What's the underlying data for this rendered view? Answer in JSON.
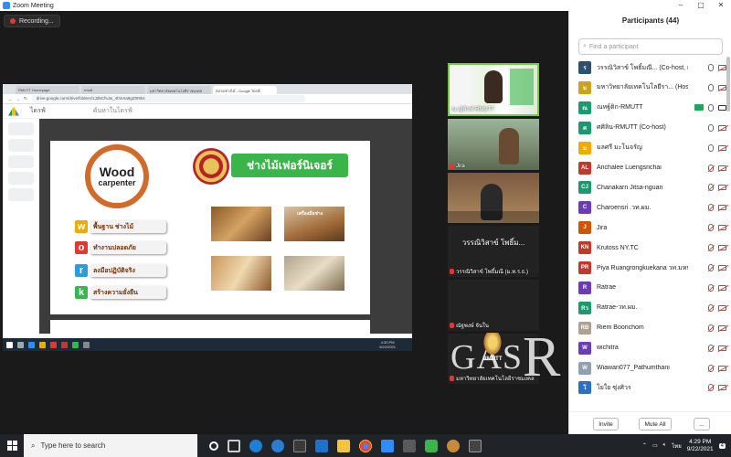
{
  "window": {
    "title": "Zoom Meeting"
  },
  "recording": {
    "label": "Recording..."
  },
  "browser": {
    "tabs": [
      "RMUTT Homepage",
      "rmutt",
      "มหาวิทยาลัยเทคโนโลยีราชมงคล",
      "ตลาดช่างไม้ - Google ไดรฟ์"
    ],
    "url": "drive.google.com/drive/folders/1Jd5CfsJw_4f4nXa8gZ0I9k4"
  },
  "drive": {
    "app_label": "ไดรฟ์",
    "search_label": "ค้นหาในไดรฟ์"
  },
  "slide": {
    "logo_line1": "Wood",
    "logo_line2": "carpenter",
    "title": "ช่างไม้เฟอร์นิเจอร์",
    "photo_caption": "เครื่องมือช่าง",
    "items": [
      {
        "letter": "w",
        "text": "พื้นฐาน ช่างไม้",
        "color": "#f2a900"
      },
      {
        "letter": "o",
        "text": "ทำงานปลอดภัย",
        "color": "#e0392f"
      },
      {
        "letter": "r",
        "text": "ลงมือปฏิบัติจริง",
        "color": "#2d9cdb"
      },
      {
        "letter": "k",
        "text": "สร้างความยั่งยืน",
        "color": "#3ab54a"
      }
    ]
  },
  "share_clock": {
    "time": "4:30 PM",
    "date": "9/22/2021"
  },
  "videos": [
    {
      "name": "ณ.ญ์ฟัวฬ-RMUTT",
      "muted": false
    },
    {
      "name": "Jira",
      "muted": true
    },
    {
      "name": "",
      "muted": false
    },
    {
      "name": "วรรณิวิสาข์ โพธิ์มณี (ม.ท.ร.ธ.)",
      "muted": true,
      "big_text": "วรรณิวิสาข์ โพธิ์ม..."
    },
    {
      "name": "ณัฐพงษ์ จันใน",
      "muted": true
    },
    {
      "name": "มหาวิทยาลัยเทคโนโลยีราชมงคล",
      "muted": true
    }
  ],
  "watermark": {
    "prefix": "GAS",
    "letter": "R"
  },
  "rmutt_label": "RMUTT",
  "participants": {
    "title": "Participants (44)",
    "search_placeholder": "Find a participant",
    "list": [
      {
        "initials": "ร",
        "color": "#2f4f6f",
        "name": "วรรณิวิสาข์ โพธิ์มณี... (Co-host, me)",
        "mic": "on",
        "cam": "off"
      },
      {
        "initials": "ม",
        "color": "#c9a227",
        "name": "มหาวิทยาลัยเทคโนโลยีรา... (Host)",
        "mic": "on",
        "cam": "off"
      },
      {
        "initials": "ณ",
        "color": "#1c9a6e",
        "name": "ณหฐ์ติก-RMUTT",
        "mic": "on",
        "cam": "on"
      },
      {
        "initials": "ศ",
        "color": "#1c9a6e",
        "name": "ศศิลิน-RMUTT (Co-host)",
        "mic": "on",
        "cam": "off"
      },
      {
        "initials": "ม",
        "color": "#f2a900",
        "name": "มลศรี มะโนจรัญ",
        "mic": "on",
        "cam": "off"
      },
      {
        "initials": "AL",
        "color": "#c0392b",
        "name": "Anchalee Luengsrichai",
        "mic": "muted",
        "cam": "off"
      },
      {
        "initials": "CJ",
        "color": "#1c9a6e",
        "name": "Chanakarn Jitsa-nguan",
        "mic": "muted",
        "cam": "off"
      },
      {
        "initials": "C",
        "color": "#6c3bb8",
        "name": "Charoensri .วท.ผม.",
        "mic": "muted",
        "cam": "off"
      },
      {
        "initials": "J",
        "color": "#d35400",
        "name": "Jira",
        "mic": "muted",
        "cam": "off"
      },
      {
        "initials": "KN",
        "color": "#c0392b",
        "name": "Krutoss NY.TC",
        "mic": "muted",
        "cam": "off"
      },
      {
        "initials": "PR",
        "color": "#c0392b",
        "name": "Piya Ruangrongkuekana วท.มหนคร",
        "mic": "muted",
        "cam": "off"
      },
      {
        "initials": "R",
        "color": "#6c3bb8",
        "name": "Ratrae",
        "mic": "muted",
        "cam": "off"
      },
      {
        "initials": "Rว",
        "color": "#1c9a6e",
        "name": "Ratrae-วท.ผม.",
        "mic": "muted",
        "cam": "off"
      },
      {
        "initials": "RB",
        "color": "#b0a090",
        "name": "Riem Boonchom",
        "mic": "muted",
        "cam": "off"
      },
      {
        "initials": "W",
        "color": "#6c3bb8",
        "name": "wichitra",
        "mic": "muted",
        "cam": "off"
      },
      {
        "initials": "W",
        "color": "#8fa0b0",
        "name": "Wiawan077_Pathumthani",
        "mic": "muted",
        "cam": "off"
      },
      {
        "initials": "โ",
        "color": "#2f6fbf",
        "name": "โยใย ซุ่งศิวร",
        "mic": "muted",
        "cam": "off"
      }
    ],
    "invite_label": "Invite",
    "mute_all_label": "Mute All",
    "more_label": "..."
  },
  "taskbar": {
    "search_placeholder": "Type here to search",
    "time": "4:29 PM",
    "date": "9/22/2021",
    "lang": "ไทย",
    "notification_count": "4"
  }
}
